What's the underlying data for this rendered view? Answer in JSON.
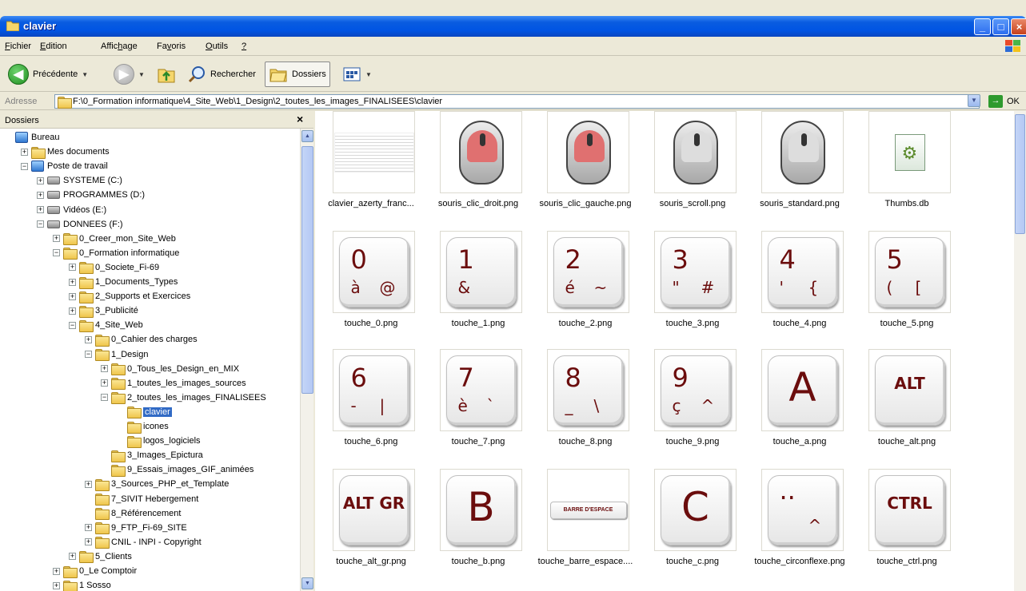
{
  "window": {
    "title": "clavier"
  },
  "menu": [
    {
      "key": "F",
      "rest": "ichier"
    },
    {
      "key": "E",
      "rest": "dition"
    },
    {
      "pre": "Affic",
      "key": "h",
      "rest": "age"
    },
    {
      "pre": "Fa",
      "key": "v",
      "rest": "oris"
    },
    {
      "key": "O",
      "rest": "utils"
    },
    {
      "key": "?",
      "rest": ""
    }
  ],
  "toolbar": {
    "back_label": "Précédente",
    "search_label": "Rechercher",
    "folders_label": "Dossiers"
  },
  "address": {
    "label": "Adresse",
    "path": "F:\\0_Formation informatique\\4_Site_Web\\1_Design\\2_toutes_les_images_FINALISEES\\clavier",
    "ok_label": "OK"
  },
  "folder_pane": {
    "title": "Dossiers",
    "close": "×",
    "items": [
      {
        "label": "Bureau",
        "depth": 0,
        "pm": "none",
        "icon": "desktop"
      },
      {
        "label": "Mes documents",
        "depth": 1,
        "pm": "+",
        "icon": "folder"
      },
      {
        "label": "Poste de travail",
        "depth": 1,
        "pm": "-",
        "icon": "computer"
      },
      {
        "label": "SYSTEME (C:)",
        "depth": 2,
        "pm": "+",
        "icon": "drive"
      },
      {
        "label": "PROGRAMMES (D:)",
        "depth": 2,
        "pm": "+",
        "icon": "drive"
      },
      {
        "label": "Vidéos (E:)",
        "depth": 2,
        "pm": "+",
        "icon": "drive"
      },
      {
        "label": "DONNEES (F:)",
        "depth": 2,
        "pm": "-",
        "icon": "drive"
      },
      {
        "label": "0_Creer_mon_Site_Web",
        "depth": 3,
        "pm": "+",
        "icon": "folder"
      },
      {
        "label": "0_Formation informatique",
        "depth": 3,
        "pm": "-",
        "icon": "folder"
      },
      {
        "label": "0_Societe_Fi-69",
        "depth": 4,
        "pm": "+",
        "icon": "folder"
      },
      {
        "label": "1_Documents_Types",
        "depth": 4,
        "pm": "+",
        "icon": "folder"
      },
      {
        "label": "2_Supports et Exercices",
        "depth": 4,
        "pm": "+",
        "icon": "folder"
      },
      {
        "label": "3_Publicité",
        "depth": 4,
        "pm": "+",
        "icon": "folder"
      },
      {
        "label": "4_Site_Web",
        "depth": 4,
        "pm": "-",
        "icon": "folder"
      },
      {
        "label": "0_Cahier des charges",
        "depth": 5,
        "pm": "+",
        "icon": "folder"
      },
      {
        "label": "1_Design",
        "depth": 5,
        "pm": "-",
        "icon": "folder"
      },
      {
        "label": "0_Tous_les_Design_en_MIX",
        "depth": 6,
        "pm": "+",
        "icon": "folder"
      },
      {
        "label": "1_toutes_les_images_sources",
        "depth": 6,
        "pm": "+",
        "icon": "folder"
      },
      {
        "label": "2_toutes_les_images_FINALISEES",
        "depth": 6,
        "pm": "-",
        "icon": "folder"
      },
      {
        "label": "clavier",
        "depth": 7,
        "pm": "none",
        "icon": "folder",
        "selected": true
      },
      {
        "label": "icones",
        "depth": 7,
        "pm": "none",
        "icon": "folder"
      },
      {
        "label": "logos_logiciels",
        "depth": 7,
        "pm": "none",
        "icon": "folder"
      },
      {
        "label": "3_Images_Epictura",
        "depth": 6,
        "pm": "none",
        "icon": "folder"
      },
      {
        "label": "9_Essais_images_GIF_animées",
        "depth": 6,
        "pm": "none",
        "icon": "folder"
      },
      {
        "label": "3_Sources_PHP_et_Template",
        "depth": 5,
        "pm": "+",
        "icon": "folder"
      },
      {
        "label": "7_SIVIT Hebergement",
        "depth": 5,
        "pm": "none",
        "icon": "folder"
      },
      {
        "label": "8_Référencement",
        "depth": 5,
        "pm": "none",
        "icon": "folder"
      },
      {
        "label": "9_FTP_Fi-69_SITE",
        "depth": 5,
        "pm": "+",
        "icon": "folder"
      },
      {
        "label": "CNIL - INPI - Copyright",
        "depth": 5,
        "pm": "+",
        "icon": "folder"
      },
      {
        "label": "5_Clients",
        "depth": 4,
        "pm": "+",
        "icon": "folder"
      },
      {
        "label": "0_Le Comptoir",
        "depth": 3,
        "pm": "+",
        "icon": "folder"
      },
      {
        "label": "1 Sosso",
        "depth": 3,
        "pm": "+",
        "icon": "folder"
      }
    ]
  },
  "files": [
    {
      "name": "clavier_azerty_franc...",
      "kind": "keyboard"
    },
    {
      "name": "souris_clic_droit.png",
      "kind": "mouse",
      "color": "#e07070"
    },
    {
      "name": "souris_clic_gauche.png",
      "kind": "mouse",
      "color": "#e07070"
    },
    {
      "name": "souris_scroll.png",
      "kind": "mouse",
      "color": "#dddddd"
    },
    {
      "name": "souris_standard.png",
      "kind": "mouse",
      "color": "#dddddd"
    },
    {
      "name": "Thumbs.db",
      "kind": "db"
    },
    {
      "name": "touche_0.png",
      "kind": "key",
      "main": "0",
      "sub": "à",
      "sub2": "@"
    },
    {
      "name": "touche_1.png",
      "kind": "key",
      "main": "1",
      "sub": "&",
      "sub2": ""
    },
    {
      "name": "touche_2.png",
      "kind": "key",
      "main": "2",
      "sub": "é",
      "sub2": "~"
    },
    {
      "name": "touche_3.png",
      "kind": "key",
      "main": "3",
      "sub": "\"",
      "sub2": "#"
    },
    {
      "name": "touche_4.png",
      "kind": "key",
      "main": "4",
      "sub": "'",
      "sub2": "{"
    },
    {
      "name": "touche_5.png",
      "kind": "key",
      "main": "5",
      "sub": "(",
      "sub2": "["
    },
    {
      "name": "touche_6.png",
      "kind": "key",
      "main": "6",
      "sub": "-",
      "sub2": "|"
    },
    {
      "name": "touche_7.png",
      "kind": "key",
      "main": "7",
      "sub": "è",
      "sub2": "`"
    },
    {
      "name": "touche_8.png",
      "kind": "key",
      "main": "8",
      "sub": "_",
      "sub2": "\\"
    },
    {
      "name": "touche_9.png",
      "kind": "key",
      "main": "9",
      "sub": "ç",
      "sub2": "^"
    },
    {
      "name": "touche_a.png",
      "kind": "letter",
      "main": "A"
    },
    {
      "name": "touche_alt.png",
      "kind": "word",
      "main": "ALT"
    },
    {
      "name": "touche_alt_gr.png",
      "kind": "word",
      "main": "ALT GR"
    },
    {
      "name": "touche_b.png",
      "kind": "letter",
      "main": "B"
    },
    {
      "name": "touche_barre_espace....",
      "kind": "space",
      "main": "BARRE D'ESPACE"
    },
    {
      "name": "touche_c.png",
      "kind": "letter",
      "main": "C"
    },
    {
      "name": "touche_circonflexe.png",
      "kind": "key",
      "main": "··",
      "sub": "",
      "sub2": "^"
    },
    {
      "name": "touche_ctrl.png",
      "kind": "word",
      "main": "CTRL"
    }
  ]
}
